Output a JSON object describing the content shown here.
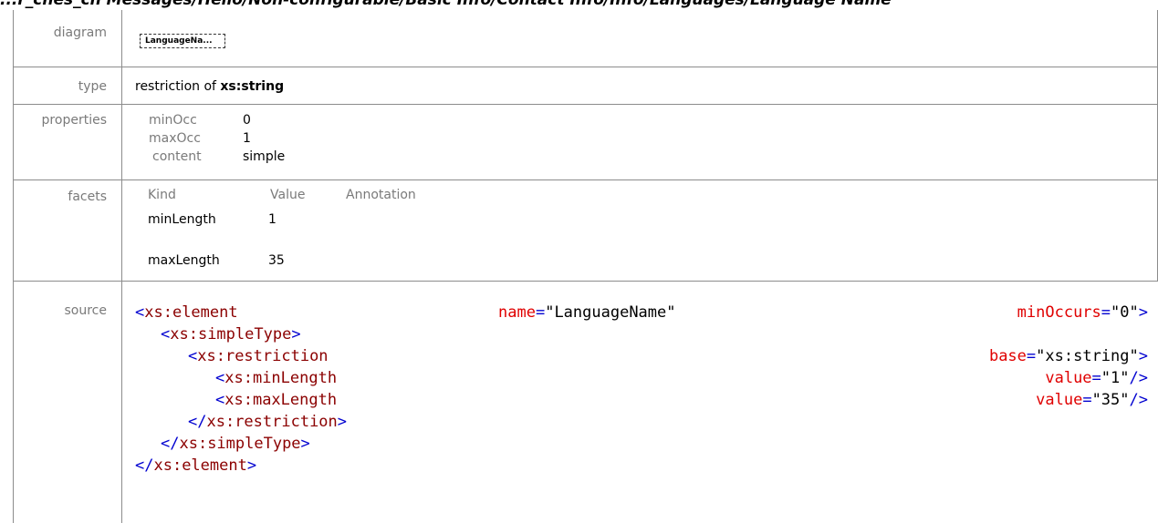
{
  "header": {
    "title": "...r_ches_ch  Messages/Hello/Non-configurable/Basic Info/Contact Info/Info/Languages/Language Name"
  },
  "rows": {
    "diagram": {
      "label": "diagram",
      "box_text": "LanguageNa..."
    },
    "type": {
      "label": "type",
      "prefix": "restriction of ",
      "base": "xs:string"
    },
    "properties": {
      "label": "properties",
      "items": [
        {
          "key": "minOcc",
          "value": "0"
        },
        {
          "key": "maxOcc",
          "value": "1"
        },
        {
          "key": "content",
          "value": "simple"
        }
      ]
    },
    "facets": {
      "label": "facets",
      "headers": [
        "Kind",
        "Value",
        "Annotation"
      ],
      "items": [
        {
          "kind": "minLength",
          "value": "1"
        },
        {
          "kind": "maxLength",
          "value": "35"
        }
      ]
    },
    "source": {
      "label": "source",
      "lines": [
        {
          "indent": 0,
          "open": "<",
          "tag": "xs:element",
          "mid_attr": "name",
          "mid_val": "\"LanguageName\"",
          "attr": "minOccurs",
          "eq": "=",
          "val": "\"0\"",
          "close": ">"
        },
        {
          "indent": 1,
          "open": "<",
          "tag": "xs:simpleType",
          "close": ">"
        },
        {
          "indent": 2,
          "open": "<",
          "tag": "xs:restriction",
          "attr": "base",
          "eq": "=",
          "val": "\"xs:string\"",
          "close": ">"
        },
        {
          "indent": 3,
          "open": "<",
          "tag": "xs:minLength",
          "attr": "value",
          "eq": "=",
          "val": "\"1\"",
          "close": "/>"
        },
        {
          "indent": 3,
          "open": "<",
          "tag": "xs:maxLength",
          "attr": "value",
          "eq": "=",
          "val": "\"35\"",
          "close": "/>"
        },
        {
          "indent": 2,
          "open": "</",
          "tag": "xs:restriction",
          "close": ">"
        },
        {
          "indent": 1,
          "open": "</",
          "tag": "xs:simpleType",
          "close": ">"
        },
        {
          "indent": 0,
          "open": "</",
          "tag": "xs:element",
          "close": ">"
        }
      ]
    }
  },
  "colors": {
    "tag": "#8b0000",
    "punct": "#0000d0",
    "attr": "#e00000",
    "label": "#7a7a7a",
    "border": "#8c8c8c"
  }
}
